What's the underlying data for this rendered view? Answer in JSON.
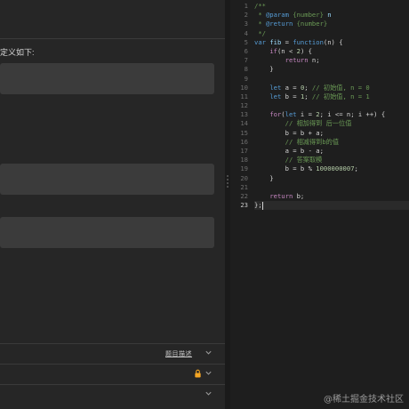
{
  "description": {
    "prompt_text": "定义如下:"
  },
  "bottom_rows": {
    "row1_badge": "题目描述"
  },
  "editor": {
    "line_numbers": [
      "1",
      "2",
      "3",
      "4",
      "5",
      "6",
      "7",
      "8",
      "9",
      "10",
      "11",
      "12",
      "13",
      "14",
      "15",
      "16",
      "17",
      "18",
      "19",
      "20",
      "21",
      "22",
      "23"
    ],
    "active_line": 23,
    "lines": [
      [
        {
          "t": "/**",
          "c": "cm"
        }
      ],
      [
        {
          "t": " * ",
          "c": "cm"
        },
        {
          "t": "@param",
          "c": "kw"
        },
        {
          "t": " {number} ",
          "c": "cm"
        },
        {
          "t": "n",
          "c": "var"
        }
      ],
      [
        {
          "t": " * ",
          "c": "cm"
        },
        {
          "t": "@return",
          "c": "kw"
        },
        {
          "t": " {number}",
          "c": "cm"
        }
      ],
      [
        {
          "t": " */",
          "c": "cm"
        }
      ],
      [
        {
          "t": "var",
          "c": "kw"
        },
        {
          "t": " ",
          "c": "op"
        },
        {
          "t": "fib",
          "c": "var"
        },
        {
          "t": " = ",
          "c": "op"
        },
        {
          "t": "function",
          "c": "kw"
        },
        {
          "t": "(n) {",
          "c": "op"
        }
      ],
      [
        {
          "t": "    ",
          "c": "op"
        },
        {
          "t": "if",
          "c": "ctrl"
        },
        {
          "t": "(n < ",
          "c": "op"
        },
        {
          "t": "2",
          "c": "num"
        },
        {
          "t": ") {",
          "c": "op"
        }
      ],
      [
        {
          "t": "        ",
          "c": "op"
        },
        {
          "t": "return",
          "c": "ctrl"
        },
        {
          "t": " n;",
          "c": "op"
        }
      ],
      [
        {
          "t": "    }",
          "c": "op"
        }
      ],
      [
        {
          "t": "",
          "c": "op"
        }
      ],
      [
        {
          "t": "    ",
          "c": "op"
        },
        {
          "t": "let",
          "c": "kw"
        },
        {
          "t": " a = ",
          "c": "op"
        },
        {
          "t": "0",
          "c": "num"
        },
        {
          "t": "; ",
          "c": "op"
        },
        {
          "t": "// 初始值, n = 0",
          "c": "cm"
        }
      ],
      [
        {
          "t": "    ",
          "c": "op"
        },
        {
          "t": "let",
          "c": "kw"
        },
        {
          "t": " b = ",
          "c": "op"
        },
        {
          "t": "1",
          "c": "num"
        },
        {
          "t": "; ",
          "c": "op"
        },
        {
          "t": "// 初始值, n = 1",
          "c": "cm"
        }
      ],
      [
        {
          "t": "",
          "c": "op"
        }
      ],
      [
        {
          "t": "    ",
          "c": "op"
        },
        {
          "t": "for",
          "c": "ctrl"
        },
        {
          "t": "(",
          "c": "op"
        },
        {
          "t": "let",
          "c": "kw"
        },
        {
          "t": " i = ",
          "c": "op"
        },
        {
          "t": "2",
          "c": "num"
        },
        {
          "t": "; i <= n; i ++) {",
          "c": "op"
        }
      ],
      [
        {
          "t": "        ",
          "c": "op"
        },
        {
          "t": "// 相加得到 后一位值",
          "c": "cm"
        }
      ],
      [
        {
          "t": "        b = b + a;",
          "c": "op"
        }
      ],
      [
        {
          "t": "        ",
          "c": "op"
        },
        {
          "t": "// 相减得到b的值",
          "c": "cm"
        }
      ],
      [
        {
          "t": "        a = b - a;",
          "c": "op"
        }
      ],
      [
        {
          "t": "        ",
          "c": "op"
        },
        {
          "t": "// 答案取模",
          "c": "cm"
        }
      ],
      [
        {
          "t": "        b = b % ",
          "c": "op"
        },
        {
          "t": "1000000007",
          "c": "num"
        },
        {
          "t": ";",
          "c": "op"
        }
      ],
      [
        {
          "t": "    }",
          "c": "op"
        }
      ],
      [
        {
          "t": "",
          "c": "op"
        }
      ],
      [
        {
          "t": "    ",
          "c": "op"
        },
        {
          "t": "return",
          "c": "ctrl"
        },
        {
          "t": " b;",
          "c": "op"
        }
      ],
      [
        {
          "t": "};",
          "c": "op"
        }
      ]
    ]
  },
  "watermark": "@稀土掘金技术社区"
}
